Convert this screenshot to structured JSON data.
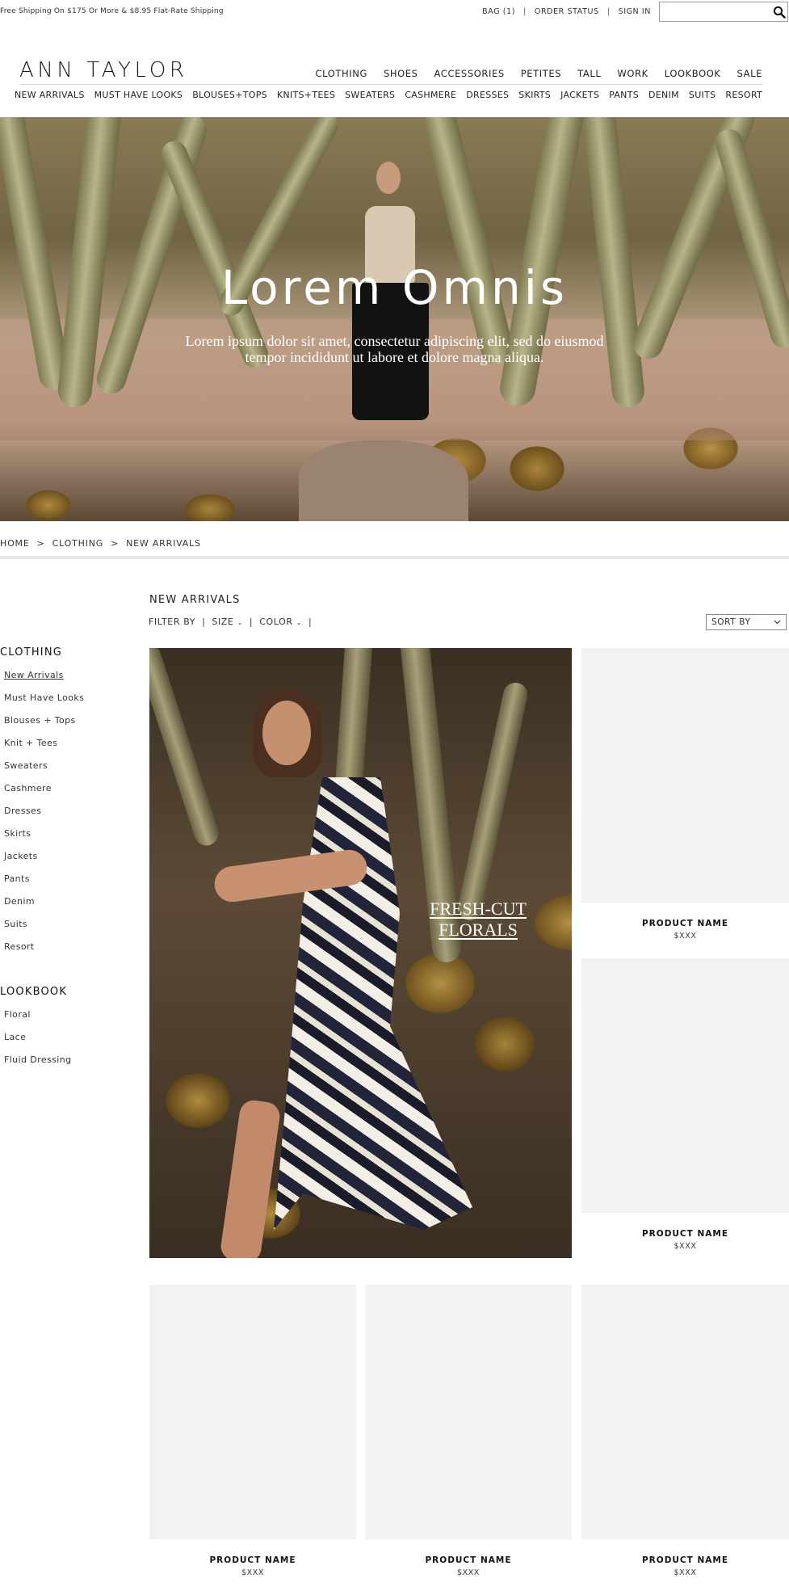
{
  "topbar": {
    "promo": "Free Shipping On $175 Or More & $8.95 Flat-Rate Shipping",
    "bag": "BAG (1)",
    "order_status": "ORDER STATUS",
    "sign_in": "SIGN IN",
    "separator": "|",
    "search_placeholder": ""
  },
  "header": {
    "logo": "ANN TAYLOR",
    "main_nav": [
      "CLOTHING",
      "SHOES",
      "ACCESSORIES",
      "PETITES",
      "TALL",
      "WORK",
      "LOOKBOOK",
      "SALE"
    ],
    "sub_nav": [
      "NEW ARRIVALS",
      "MUST HAVE LOOKS",
      "BLOUSES+TOPS",
      "KNITS+TEES",
      "SWEATERS",
      "CASHMERE",
      "DRESSES",
      "SKIRTS",
      "JACKETS",
      "PANTS",
      "DENIM",
      "SUITS",
      "RESORT"
    ]
  },
  "hero": {
    "title": "Lorem Omnis",
    "copy_line1": "Lorem ipsum dolor sit amet, consectetur adipiscing elit, sed do eiusmod",
    "copy_line2": "tempor incididunt ut labore et dolore magna aliqua."
  },
  "breadcrumb": {
    "items": [
      "HOME",
      "CLOTHING",
      "NEW ARRIVALS"
    ],
    "separator": ">"
  },
  "listing": {
    "title": "NEW ARRIVALS",
    "filter_label": "FILTER BY",
    "size_label": "SIZE",
    "color_label": "COLOR",
    "pipe": "|",
    "sort_label": "SORT BY"
  },
  "sidebar": {
    "clothing_heading": "CLOTHING",
    "clothing_items": [
      "New Arrivals",
      "Must Have Looks",
      "Blouses + Tops",
      "Knit + Tees",
      "Sweaters",
      "Cashmere",
      "Dresses",
      "Skirts",
      "Jackets",
      "Pants",
      "Denim",
      "Suits",
      "Resort"
    ],
    "active_item": "New Arrivals",
    "lookbook_heading": "LOOKBOOK",
    "lookbook_items": [
      "Floral",
      "Lace",
      "Fluid Dressing"
    ]
  },
  "feature": {
    "tag_line1": "FRESH-CUT",
    "tag_line2": "FLORALS"
  },
  "products": [
    {
      "name": "PRODUCT NAME",
      "price": "$XXX"
    },
    {
      "name": "PRODUCT NAME",
      "price": "$XXX"
    },
    {
      "name": "PRODUCT NAME",
      "price": "$XXX"
    },
    {
      "name": "PRODUCT NAME",
      "price": "$XXX"
    },
    {
      "name": "PRODUCT NAME",
      "price": "$XXX"
    }
  ],
  "icons": {
    "search": "search-icon",
    "chevron": "chevron-down-icon"
  }
}
